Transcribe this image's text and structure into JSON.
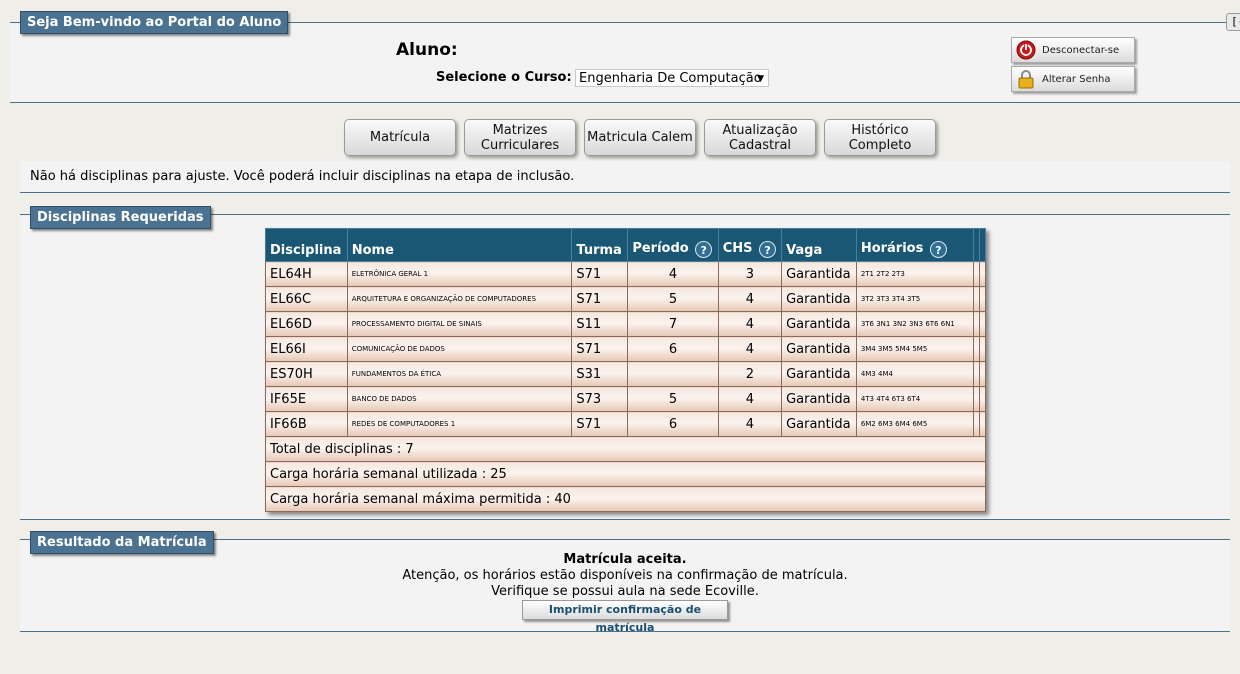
{
  "portal": {
    "title": "Seja Bem-vindo ao Portal do Aluno",
    "collapse_label": "[-]",
    "aluno_label": "Aluno:",
    "curso_label": "Selecione o Curso:",
    "curso_value": "Engenharia De Computação",
    "disconnect_label": "Desconectar-se",
    "change_password_label": "Alterar Senha"
  },
  "nav": {
    "matricula": "Matrícula",
    "matrizes": "Matrizes Curriculares",
    "calem": "Matricula Calem",
    "atualizacao": "Atualização Cadastral",
    "historico": "Histórico Completo"
  },
  "notice": "Não há disciplinas para ajuste. Você poderá incluir disciplinas na etapa de inclusão.",
  "disciplinas": {
    "title": "Disciplinas Requeridas",
    "headers": {
      "disciplina": "Disciplina",
      "nome": "Nome",
      "turma": "Turma",
      "periodo": "Período",
      "chs": "CHS",
      "vaga": "Vaga",
      "horarios": "Horários"
    },
    "help_icon": "?",
    "rows": [
      {
        "codigo": "EL64H",
        "nome": "ELETRÔNICA GERAL 1",
        "turma": "S71",
        "periodo": "4",
        "chs": "3",
        "vaga": "Garantida",
        "horarios": "2T1 2T2 2T3"
      },
      {
        "codigo": "EL66C",
        "nome": "ARQUITETURA E ORGANIZAÇÃO DE COMPUTADORES",
        "turma": "S71",
        "periodo": "5",
        "chs": "4",
        "vaga": "Garantida",
        "horarios": "3T2 3T3 3T4 3T5"
      },
      {
        "codigo": "EL66D",
        "nome": "PROCESSAMENTO DIGITAL DE SINAIS",
        "turma": "S11",
        "periodo": "7",
        "chs": "4",
        "vaga": "Garantida",
        "horarios": "3T6 3N1 3N2 3N3 6T6 6N1"
      },
      {
        "codigo": "EL66I",
        "nome": "COMUNICAÇÃO DE DADOS",
        "turma": "S71",
        "periodo": "6",
        "chs": "4",
        "vaga": "Garantida",
        "horarios": "3M4 3M5 5M4 5M5"
      },
      {
        "codigo": "ES70H",
        "nome": "FUNDAMENTOS DA ÉTICA",
        "turma": "S31",
        "periodo": "",
        "chs": "2",
        "vaga": "Garantida",
        "horarios": "4M3 4M4"
      },
      {
        "codigo": "IF65E",
        "nome": "BANCO DE DADOS",
        "turma": "S73",
        "periodo": "5",
        "chs": "4",
        "vaga": "Garantida",
        "horarios": "4T3 4T4 6T3 6T4"
      },
      {
        "codigo": "IF66B",
        "nome": "REDES DE COMPUTADORES 1",
        "turma": "S71",
        "periodo": "6",
        "chs": "4",
        "vaga": "Garantida",
        "horarios": "6M2 6M3 6M4 6M5"
      }
    ],
    "total": "Total de disciplinas : 7",
    "carga_utilizada": "Carga horária semanal utilizada : 25",
    "carga_maxima": "Carga horária semanal máxima permitida : 40"
  },
  "resultado": {
    "title": "Resultado da Matrícula",
    "status": "Matrícula aceita.",
    "line1": "Atenção, os horários estão disponíveis na confirmação de matrícula.",
    "line2": "Verifique se possui aula na sede Ecoville.",
    "print_button": "Imprimir confirmação de matrícula"
  },
  "colors": {
    "panel_title_bg": "#4b7391",
    "table_header_bg": "#1a5774",
    "row_tint": "#e6c7b4"
  },
  "icons": {
    "disconnect": "power-icon",
    "change_password": "lock-icon",
    "help": "help-icon"
  }
}
